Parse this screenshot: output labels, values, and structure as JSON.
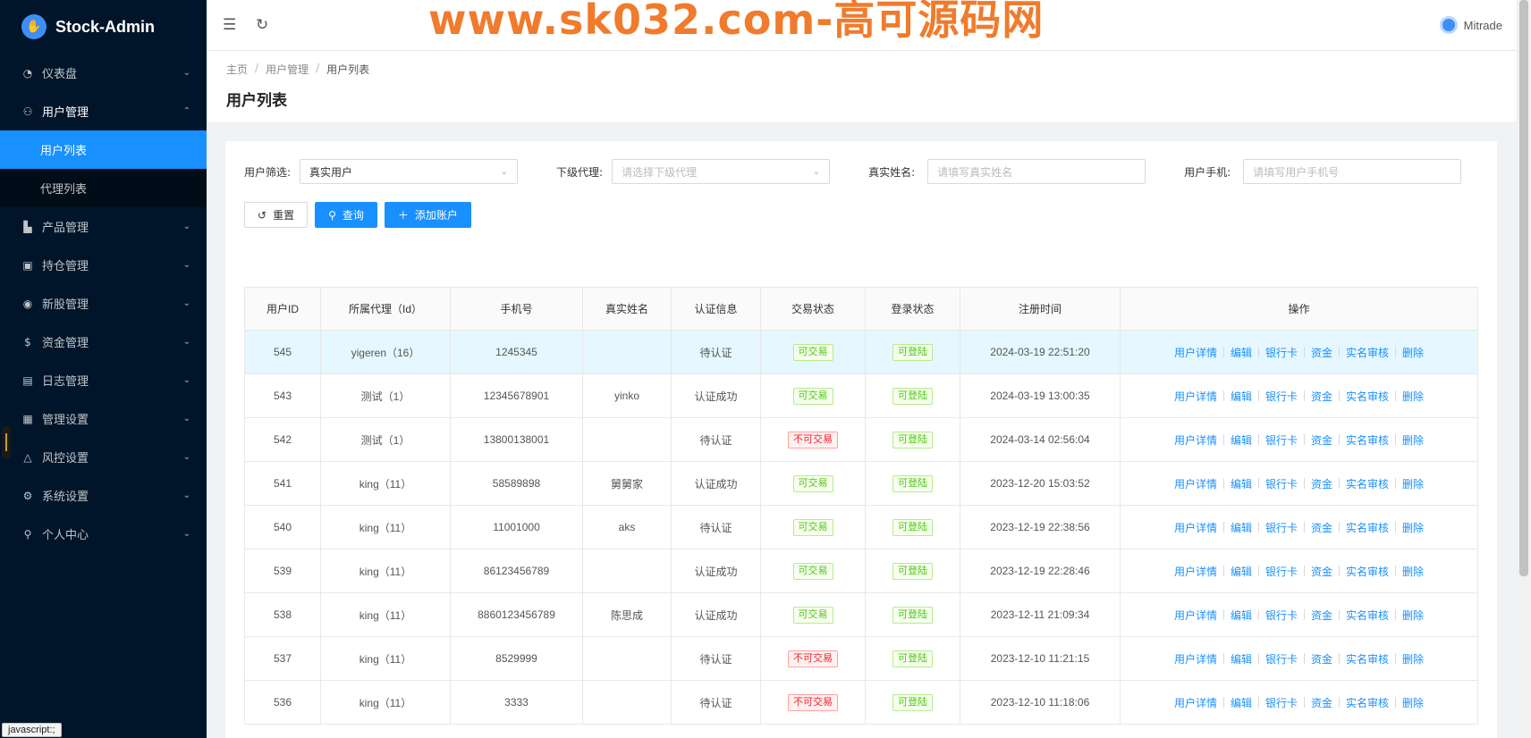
{
  "app": {
    "name": "Stock-Admin"
  },
  "watermark": "www.sk032.com-高可源码网",
  "user": {
    "name": "Mitrade"
  },
  "sidebar": {
    "items": [
      {
        "label": "仪表盘",
        "icon": "dashboard-icon"
      },
      {
        "label": "用户管理",
        "icon": "user-manage-icon"
      },
      {
        "label": "产品管理",
        "icon": "product-icon"
      },
      {
        "label": "持仓管理",
        "icon": "position-icon"
      },
      {
        "label": "新股管理",
        "icon": "ipo-icon"
      },
      {
        "label": "资金管理",
        "icon": "fund-icon"
      },
      {
        "label": "日志管理",
        "icon": "log-icon"
      },
      {
        "label": "管理设置",
        "icon": "admin-settings-icon"
      },
      {
        "label": "风控设置",
        "icon": "risk-icon"
      },
      {
        "label": "系统设置",
        "icon": "system-settings-icon"
      },
      {
        "label": "个人中心",
        "icon": "profile-icon"
      }
    ],
    "sub_items": [
      "用户列表",
      "代理列表"
    ]
  },
  "breadcrumb": {
    "home": "主页",
    "section": "用户管理",
    "current": "用户列表"
  },
  "page_title": "用户列表",
  "filters": {
    "user_filter_label": "用户筛选:",
    "user_filter_value": "真实用户",
    "agent_label": "下级代理:",
    "agent_placeholder": "请选择下级代理",
    "realname_label": "真实姓名:",
    "realname_placeholder": "请填写真实姓名",
    "phone_label": "用户手机:",
    "phone_placeholder": "请填写用户手机号"
  },
  "buttons": {
    "reset": "重置",
    "search": "查询",
    "add": "添加账户"
  },
  "table": {
    "headers": [
      "用户ID",
      "所属代理（Id）",
      "手机号",
      "真实姓名",
      "认证信息",
      "交易状态",
      "登录状态",
      "注册时间",
      "操作"
    ],
    "op_labels": [
      "用户详情",
      "编辑",
      "银行卡",
      "资金",
      "实名审核",
      "删除"
    ],
    "rows": [
      {
        "id": "545",
        "agent": "yigeren（16）",
        "phone": "1245345",
        "name": "",
        "auth": "待认证",
        "trade": "可交易",
        "trade_ok": true,
        "login": "可登陆",
        "time": "2024-03-19 22:51:20"
      },
      {
        "id": "543",
        "agent": "测试（1）",
        "phone": "12345678901",
        "name": "yinko",
        "auth": "认证成功",
        "trade": "可交易",
        "trade_ok": true,
        "login": "可登陆",
        "time": "2024-03-19 13:00:35"
      },
      {
        "id": "542",
        "agent": "测试（1）",
        "phone": "13800138001",
        "name": "",
        "auth": "待认证",
        "trade": "不可交易",
        "trade_ok": false,
        "login": "可登陆",
        "time": "2024-03-14 02:56:04"
      },
      {
        "id": "541",
        "agent": "king（11）",
        "phone": "58589898",
        "name": "舅舅家",
        "auth": "认证成功",
        "trade": "可交易",
        "trade_ok": true,
        "login": "可登陆",
        "time": "2023-12-20 15:03:52"
      },
      {
        "id": "540",
        "agent": "king（11）",
        "phone": "11001000",
        "name": "aks",
        "auth": "待认证",
        "trade": "可交易",
        "trade_ok": true,
        "login": "可登陆",
        "time": "2023-12-19 22:38:56"
      },
      {
        "id": "539",
        "agent": "king（11）",
        "phone": "86123456789",
        "name": "",
        "auth": "认证成功",
        "trade": "可交易",
        "trade_ok": true,
        "login": "可登陆",
        "time": "2023-12-19 22:28:46"
      },
      {
        "id": "538",
        "agent": "king（11）",
        "phone": "8860123456789",
        "name": "陈思成",
        "auth": "认证成功",
        "trade": "可交易",
        "trade_ok": true,
        "login": "可登陆",
        "time": "2023-12-11 21:09:34"
      },
      {
        "id": "537",
        "agent": "king（11）",
        "phone": "8529999",
        "name": "",
        "auth": "待认证",
        "trade": "不可交易",
        "trade_ok": false,
        "login": "可登陆",
        "time": "2023-12-10 11:21:15"
      },
      {
        "id": "536",
        "agent": "king（11）",
        "phone": "3333",
        "name": "",
        "auth": "待认证",
        "trade": "不可交易",
        "trade_ok": false,
        "login": "可登陆",
        "time": "2023-12-10 11:18:06"
      }
    ]
  },
  "status_tip": "javascript:;"
}
